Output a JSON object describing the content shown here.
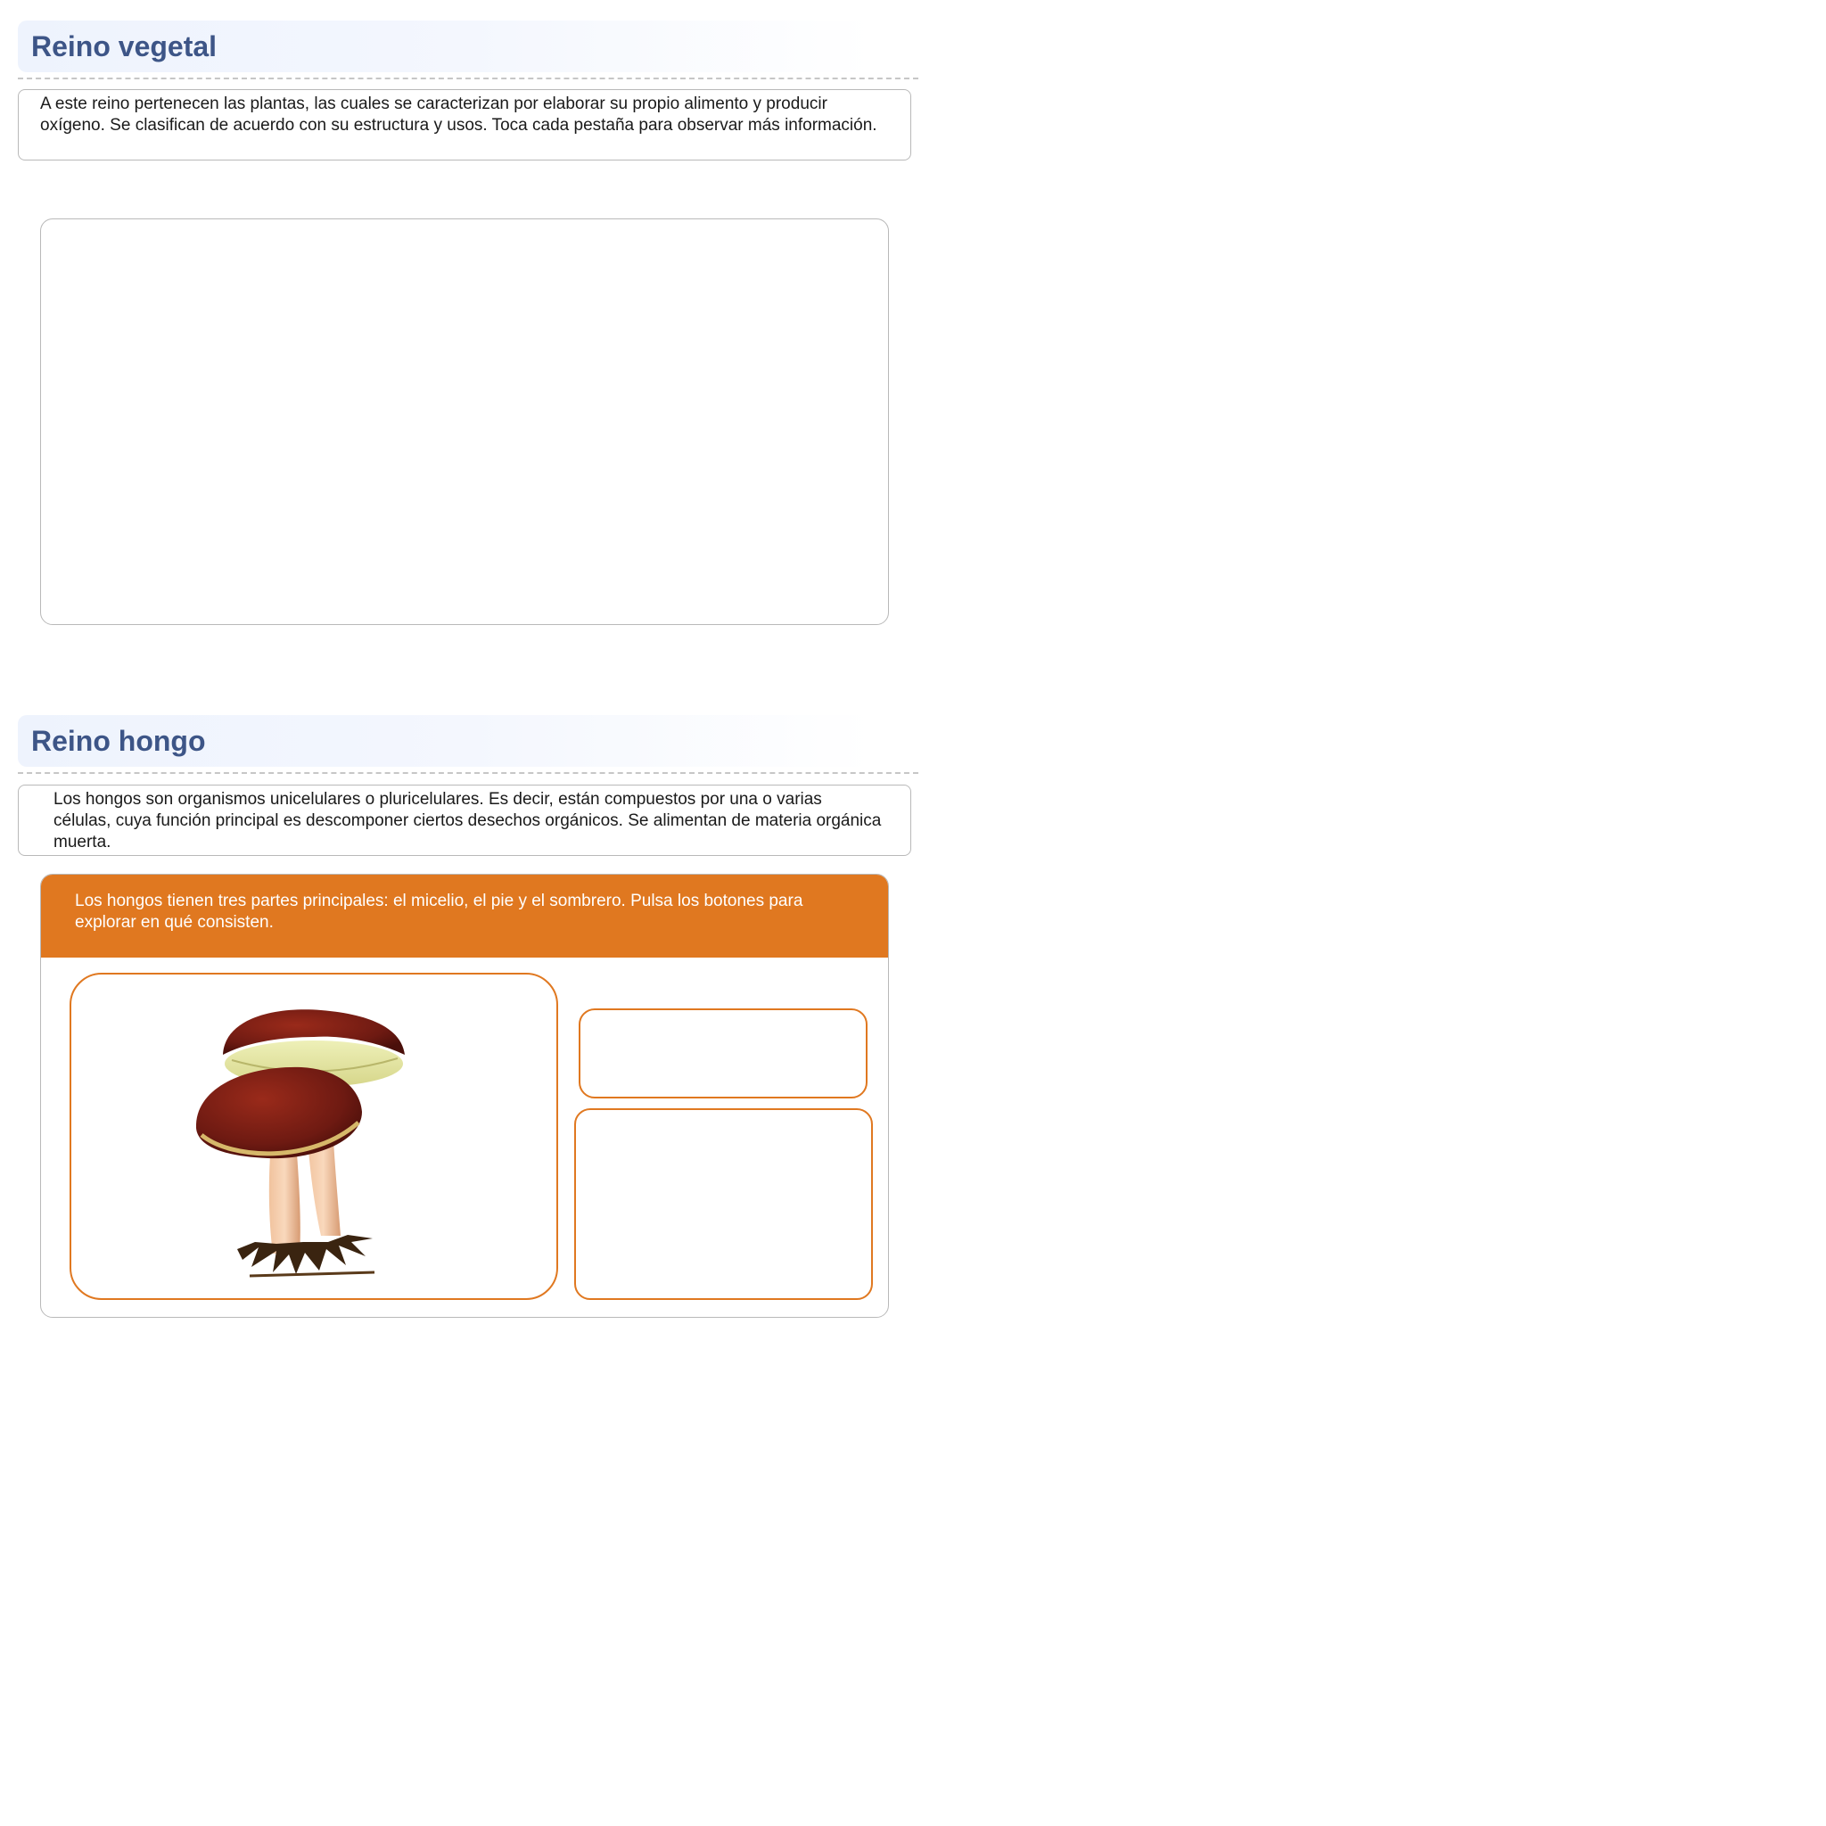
{
  "sections": [
    {
      "title": "Reino vegetal",
      "description": "A este reino pertenecen las plantas, las cuales se caracterizan por elaborar su propio alimento y producir oxígeno. Se clasifican de acuerdo con su estructura y usos. Toca cada pestaña para observar más información."
    },
    {
      "title": "Reino hongo",
      "description": "Los hongos son organismos unicelulares o pluricelulares. Es decir, están compuestos por una o varias células, cuya función principal es descomponer ciertos desechos orgánicos. Se alimentan de materia orgánica muerta."
    }
  ],
  "fungi_activity": {
    "instruction": "Los hongos tienen tres partes principales: el micelio, el pie y el sombrero. Pulsa los botones para explorar en qué consisten.",
    "image_icon": "mushroom-illustration",
    "accent_color": "#e07820"
  },
  "colors": {
    "title": "#3d5587",
    "header_bg": "#eef3fd",
    "accent": "#e07820",
    "border": "#b9b9b9"
  }
}
